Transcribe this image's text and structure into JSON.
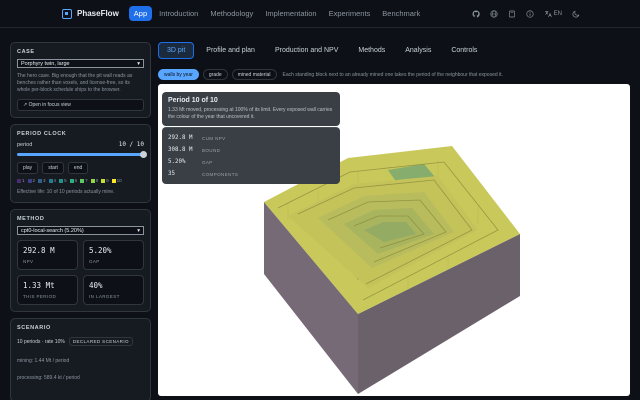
{
  "nav": {
    "brand": "PhaseFlow",
    "links": [
      "App",
      "Introduction",
      "Methodology",
      "Implementation",
      "Experiments",
      "Benchmark"
    ],
    "active": "App",
    "lang": "EN",
    "icons": [
      "github-icon",
      "globe-icon",
      "book-icon",
      "info-icon",
      "translate-icon",
      "moon-icon"
    ]
  },
  "case": {
    "title": "CASE",
    "selected": "Porphyry twin, large",
    "description": "The hero case. Big enough that the pit wall reads as benches rather than voxels, and license-free, so its whole per-block schedule ships to the browser.",
    "focus_button": "Open in focus view"
  },
  "clock": {
    "title": "PERIOD CLOCK",
    "label": "period",
    "value": "10 / 10",
    "progress": 1.0,
    "buttons": [
      "play",
      "start",
      "end"
    ],
    "legend": [
      {
        "n": "1",
        "color": "#4b2c6e"
      },
      {
        "n": "2",
        "color": "#3d3f86"
      },
      {
        "n": "3",
        "color": "#335d8c"
      },
      {
        "n": "4",
        "color": "#287a8e"
      },
      {
        "n": "5",
        "color": "#21918c"
      },
      {
        "n": "6",
        "color": "#2fae7f"
      },
      {
        "n": "7",
        "color": "#5ec962"
      },
      {
        "n": "8",
        "color": "#8fd744"
      },
      {
        "n": "9",
        "color": "#c6de2f"
      },
      {
        "n": "10",
        "color": "#fde725"
      }
    ],
    "note": "Effective life: 10 of 10 periods actually mine."
  },
  "method": {
    "title": "METHOD",
    "selected": "cpt0-local-search (5.20%)",
    "stats": [
      {
        "value": "292.8 M",
        "label": "NPV"
      },
      {
        "value": "5.20%",
        "label": "GAP"
      },
      {
        "value": "1.33 Mt",
        "label": "THIS PERIOD"
      },
      {
        "value": "40%",
        "label": "IN LARGEST"
      }
    ]
  },
  "scenario": {
    "title": "SCENARIO",
    "summary": "10 periods · rate 10%",
    "badge": "DECLARED SCENARIO",
    "mining": "mining: 1.44 Mt / period",
    "processing": "processing: 589.4 kt / period"
  },
  "tabs": [
    "3D pit",
    "Profile and plan",
    "Production and NPV",
    "Methods",
    "Analysis",
    "Controls"
  ],
  "active_tab": "3D pit",
  "chips": [
    "walls by year",
    "grade",
    "mined material"
  ],
  "active_chip": "walls by year",
  "chip_hint": "Each standing block next to an already mined one takes the period of the neighbour that exposed it.",
  "overlay": {
    "title": "Period 10 of 10",
    "text": "1.33 Mt moved, processing at 100% of its limit. Every exposed wall carries the colour of the year that uncovered it.",
    "stats": [
      {
        "value": "292.8 M",
        "label": "CUM NPV"
      },
      {
        "value": "308.8 M",
        "label": "BOUND"
      },
      {
        "value": "5.20%",
        "label": "GAP"
      },
      {
        "value": "35",
        "label": "COMPONENTS"
      }
    ]
  },
  "colors": {
    "accent": "#1f6feb",
    "link": "#58a6ff",
    "wall_yellow": "#c9c85a",
    "wall_green": "#7fa86b",
    "pit_side": "#6e6470"
  }
}
